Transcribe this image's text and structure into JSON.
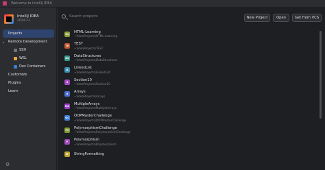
{
  "window": {
    "title": "Welcome to IntelliJ IDEA"
  },
  "brand": {
    "name": "IntelliJ IDEA",
    "version": "2024.2.1"
  },
  "sidebar": {
    "items": [
      {
        "label": "Projects",
        "active": true
      },
      {
        "label": "Remote Development",
        "expandable": true
      },
      {
        "label": "SSH",
        "sub": true
      },
      {
        "label": "WSL",
        "sub": true
      },
      {
        "label": "Dev Containers",
        "sub": true
      },
      {
        "label": "Customize"
      },
      {
        "label": "Plugins"
      },
      {
        "label": "Learn"
      }
    ]
  },
  "toolbar": {
    "search_placeholder": "Search projects",
    "new_project": "New Project",
    "open": "Open",
    "get_from_vcs": "Get from VCS"
  },
  "projects": [
    {
      "initials": "HL",
      "color": "#8f9c3c",
      "name": "HTML-Learning",
      "path": "~\\IdeaProjects\\HTML-Learning"
    },
    {
      "initials": "TE",
      "color": "#c0572f",
      "name": "TEST",
      "path": "~\\IdeaProjects\\TEST"
    },
    {
      "initials": "DS",
      "color": "#3a9a8b",
      "name": "DataStructures",
      "path": "~\\IdeaProjects\\DataStructures"
    },
    {
      "initials": "LL",
      "color": "#3d8fb0",
      "name": "LinkedList",
      "path": "~\\IdeaProjects\\LinkedList"
    },
    {
      "initials": "S",
      "color": "#a34bc0",
      "name": "Section10",
      "path": "~\\IdeaProjects\\Section10"
    },
    {
      "initials": "A",
      "color": "#4a6fd1",
      "name": "Arrays",
      "path": "~\\IdeaProjects\\Arrays"
    },
    {
      "initials": "MA",
      "color": "#9b3ec2",
      "name": "MultipleArrays",
      "path": "~\\IdeaProjects\\MultipleArrays"
    },
    {
      "initials": "OC",
      "color": "#3c7fd4",
      "name": "OOPMasterChallenge",
      "path": "~\\IdeaProjects\\OOPMasterChallenge"
    },
    {
      "initials": "PC",
      "color": "#7f9a35",
      "name": "PolymorphismChallenge",
      "path": "~\\IdeaProjects\\PolymorphismChallenge"
    },
    {
      "initials": "P",
      "color": "#a04cb8",
      "name": "Polymorphism",
      "path": "~\\IdeaProjects\\Polymorphism"
    },
    {
      "initials": "SF",
      "color": "#c2a235",
      "name": "StringFormatting",
      "path": ""
    }
  ]
}
